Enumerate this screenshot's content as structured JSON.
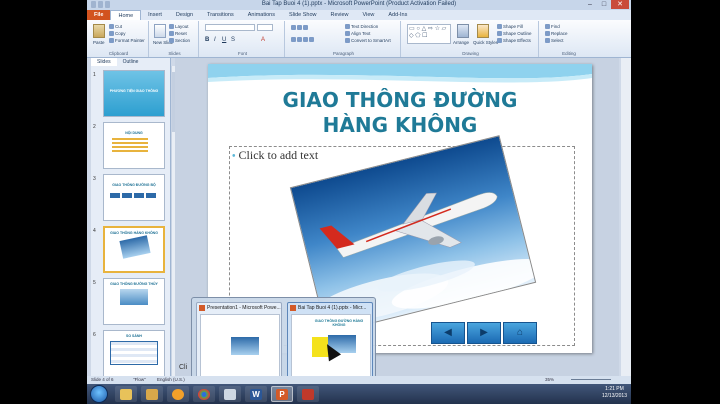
{
  "window": {
    "title": "Bai Tap Buoi 4 (1).pptx - Microsoft PowerPoint (Product Activation Failed)",
    "controls": {
      "minimize": "–",
      "maximize": "□",
      "close": "✕"
    }
  },
  "ribbon": {
    "tabs": [
      "File",
      "Home",
      "Insert",
      "Design",
      "Transitions",
      "Animations",
      "Slide Show",
      "Review",
      "View",
      "Add-Ins"
    ],
    "active_tab": "Home",
    "clipboard": {
      "paste": "Paste",
      "cut": "Cut",
      "copy": "Copy",
      "format_painter": "Format Painter",
      "label": "Clipboard"
    },
    "slides": {
      "new_slide": "New Slide",
      "layout": "Layout",
      "reset": "Reset",
      "section": "Section",
      "label": "Slides"
    },
    "font": {
      "label": "Font"
    },
    "paragraph": {
      "text_direction": "Text Direction",
      "align_text": "Align Text",
      "convert_smartart": "Convert to SmartArt",
      "label": "Paragraph"
    },
    "drawing": {
      "arrange": "Arrange",
      "quick_styles": "Quick Styles",
      "shape_fill": "Shape Fill",
      "shape_outline": "Shape Outline",
      "shape_effects": "Shape Effects",
      "label": "Drawing"
    },
    "editing": {
      "find": "Find",
      "replace": "Replace",
      "select": "Select",
      "label": "Editing"
    }
  },
  "panel": {
    "tabs": [
      "Slides",
      "Outline"
    ],
    "thumbnails": [
      {
        "num": "1",
        "text": "PHƯƠNG TIỆN GIAO THÔNG"
      },
      {
        "num": "2",
        "text": "NỘI DUNG"
      },
      {
        "num": "3",
        "text": "GIAO THÔNG ĐƯỜNG BỘ"
      },
      {
        "num": "4",
        "text": "GIAO THÔNG HÀNG KHÔNG"
      },
      {
        "num": "5",
        "text": "GIAO THÔNG ĐƯỜNG THỦY"
      },
      {
        "num": "6",
        "text": "SO SÁNH"
      }
    ]
  },
  "slide": {
    "title": "GIAO THÔNG ĐƯỜNG HÀNG KHÔNG",
    "placeholder": "Click to add text",
    "nav": [
      "◀",
      "▶",
      "⌂"
    ]
  },
  "popup": {
    "cards": [
      {
        "title": "Presentation1 - Microsoft Powe..."
      },
      {
        "title": "Bai Tap Buoi 4 (1).pptx - Micr..."
      }
    ],
    "preview_title": "GIAO THÔNG ĐƯỜNG HÀNG KHÔNG"
  },
  "status": {
    "slide_info": "Slide 4 of 6",
    "theme": "\"Flow\"",
    "language": "English (U.S.)",
    "zoom": "35%",
    "notes_fragment": "Cli"
  },
  "taskbar": {
    "apps": [
      {
        "name": "explorer-icon",
        "color": "#e8c25a"
      },
      {
        "name": "library-icon",
        "color": "#d9a84a"
      },
      {
        "name": "media-player-icon",
        "color": "#f2a02a"
      },
      {
        "name": "chrome-icon",
        "color": "#4caf50"
      },
      {
        "name": "paint-icon",
        "color": "#cfd8e3"
      },
      {
        "name": "word-icon",
        "color": "#2b5797"
      },
      {
        "name": "powerpoint-icon",
        "color": "#d35a28"
      },
      {
        "name": "screenshot-tool-icon",
        "color": "#c0392b"
      }
    ],
    "time": "1:21 PM",
    "date": "12/13/2013"
  }
}
